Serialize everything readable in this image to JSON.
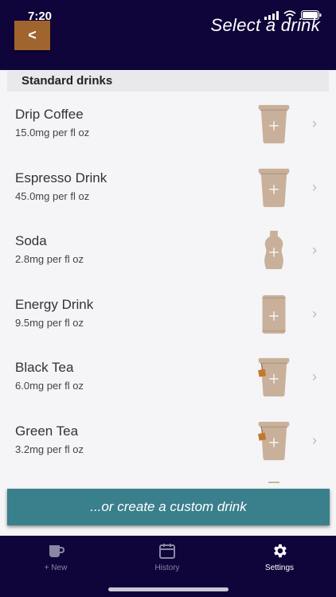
{
  "status": {
    "time": "7:20"
  },
  "header": {
    "back_label": "<",
    "title": "Select a drink"
  },
  "section": {
    "title": "Standard drinks"
  },
  "drinks": [
    {
      "name": "Drip Coffee",
      "caffeine": "15.0mg per fl oz",
      "icon": "cup-icon"
    },
    {
      "name": "Espresso Drink",
      "caffeine": "45.0mg per fl oz",
      "icon": "cup-icon"
    },
    {
      "name": "Soda",
      "caffeine": "2.8mg per fl oz",
      "icon": "bottle-icon"
    },
    {
      "name": "Energy Drink",
      "caffeine": "9.5mg per fl oz",
      "icon": "can-icon"
    },
    {
      "name": "Black Tea",
      "caffeine": "6.0mg per fl oz",
      "icon": "tea-cup-icon"
    },
    {
      "name": "Green Tea",
      "caffeine": "3.2mg per fl oz",
      "icon": "tea-cup-icon"
    }
  ],
  "custom_button": {
    "label": "...or create a custom drink"
  },
  "tabs": [
    {
      "label": "+ New",
      "icon": "coffee-cup-icon",
      "active": false
    },
    {
      "label": "History",
      "icon": "calendar-icon",
      "active": false
    },
    {
      "label": "Settings",
      "icon": "gear-icon",
      "active": true
    }
  ],
  "colors": {
    "navy": "#10053a",
    "back_button": "#a0652e",
    "cup": "#c8b09a",
    "tea_tag": "#c2782d",
    "custom_button": "#3a7f8c"
  }
}
